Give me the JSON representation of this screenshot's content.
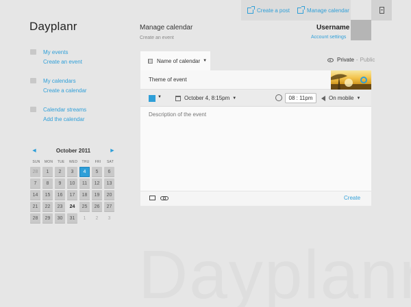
{
  "app": {
    "name": "Dayplanr",
    "watermark": "Dayplanr"
  },
  "topbar": {
    "create_post": "Create a post",
    "manage_calendar": "Manage calendar",
    "logout_icon": "door-icon"
  },
  "sidebar": {
    "groups": [
      {
        "title": "My events",
        "action": "Create an event",
        "icon": "events-icon"
      },
      {
        "title": "My calendars",
        "action": "Create a calendar",
        "icon": "calendars-icon"
      },
      {
        "title": "Calendar streams",
        "action": "Add the calendar",
        "icon": "streams-icon"
      }
    ]
  },
  "calendar": {
    "title": "October 2011",
    "prev": "◀",
    "next": "▶",
    "weekdays": [
      "SUN",
      "MON",
      "TUE",
      "WED",
      "THU",
      "FRI",
      "SAT"
    ],
    "selected_day": "4",
    "today_day": "24",
    "days": [
      "28",
      "1",
      "2",
      "3",
      "4",
      "5",
      "6",
      "7",
      "8",
      "9",
      "10",
      "11",
      "12",
      "13",
      "14",
      "15",
      "16",
      "17",
      "18",
      "19",
      "20",
      "21",
      "22",
      "23",
      "24",
      "25",
      "26",
      "27",
      "28",
      "29",
      "30",
      "31",
      "1",
      "2",
      "3"
    ],
    "day_kinds": [
      "out-first",
      "in",
      "in",
      "in",
      "sel",
      "in",
      "in",
      "in",
      "in",
      "in",
      "in",
      "in",
      "in",
      "in",
      "in",
      "in",
      "in",
      "in",
      "in",
      "in",
      "in",
      "in",
      "in",
      "in",
      "today",
      "in",
      "in",
      "in",
      "in",
      "in",
      "in",
      "in",
      "out",
      "out",
      "out"
    ]
  },
  "main": {
    "title": "Manage calendar",
    "subtitle": "Create an event",
    "username": "Username",
    "account_settings": "Account settings",
    "tab_label": "Name of calendar",
    "caret": "▼",
    "privacy": {
      "selected": "Private",
      "separator": "-",
      "other": "Public"
    }
  },
  "event_form": {
    "theme_label": "Theme of event",
    "color": "#2f9fd8",
    "date": "October 4, 8:15pm",
    "reminder_time": "08 : 11pm",
    "notify": "On mobile",
    "description": "Description of the event",
    "create": "Create"
  }
}
